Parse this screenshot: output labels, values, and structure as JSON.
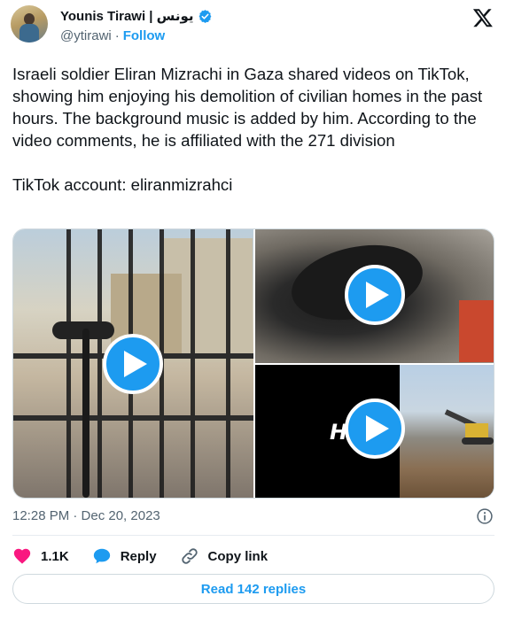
{
  "author": {
    "name": "Younis Tirawi | يونس",
    "handle": "@ytirawi",
    "separator": "·",
    "follow_label": "Follow"
  },
  "tweet": {
    "line1": "Israeli soldier Eliran Mizrachi in Gaza shared videos on TikTok, showing him enjoying his demolition of civilian homes in the past hours. The background music is added by him. According to the video comments, he is affiliated with the 271 division",
    "line2": "TikTok account: eliranmizrahci"
  },
  "media": {
    "overlay_text": "H       CK"
  },
  "meta": {
    "timestamp": "12:28 PM · Dec 20, 2023"
  },
  "actions": {
    "likes": "1.1K",
    "reply_label": "Reply",
    "copy_link_label": "Copy link"
  },
  "replies_button": "Read 142 replies",
  "colors": {
    "accent": "#1d9bf0",
    "like": "#f91880",
    "text_secondary": "#536471"
  }
}
